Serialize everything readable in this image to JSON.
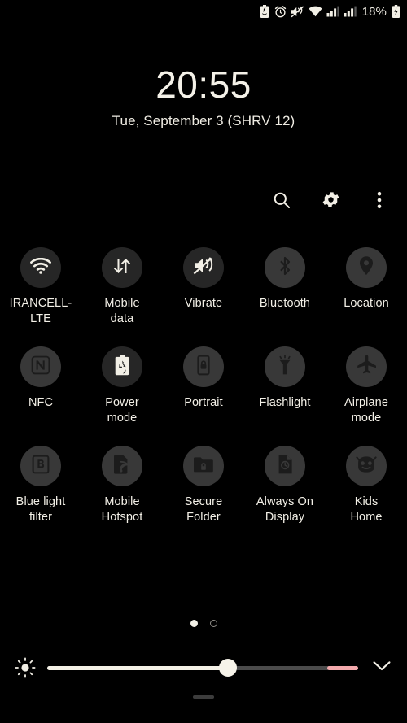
{
  "statusbar": {
    "icons": [
      {
        "name": "power-saving-icon",
        "glyph": "power-saving"
      },
      {
        "name": "alarm-icon",
        "glyph": "alarm"
      },
      {
        "name": "mute-vibrate-icon",
        "glyph": "mute"
      },
      {
        "name": "wifi-icon",
        "glyph": "wifi"
      },
      {
        "name": "signal-sim1-icon",
        "glyph": "signal"
      },
      {
        "name": "signal-sim2-icon",
        "glyph": "signal"
      }
    ],
    "battery_percent": "18%",
    "battery_state": "charging"
  },
  "header": {
    "time": "20:55",
    "date": "Tue, September 3 (SHRV 12)"
  },
  "toolbar": {
    "search_label": "search-icon",
    "settings_label": "gear-icon",
    "more_label": "more-vertical-icon"
  },
  "tiles": [
    {
      "name": "wifi",
      "label": "IRANCELL-\nLTE",
      "icon": "wifi-icon",
      "state": "on"
    },
    {
      "name": "mobile-data",
      "label": "Mobile\ndata",
      "icon": "data-arrows-icon",
      "state": "on"
    },
    {
      "name": "vibrate",
      "label": "Vibrate",
      "icon": "vibrate-icon",
      "state": "on"
    },
    {
      "name": "bluetooth",
      "label": "Bluetooth",
      "icon": "bluetooth-icon",
      "state": "off"
    },
    {
      "name": "location",
      "label": "Location",
      "icon": "location-pin-icon",
      "state": "off"
    },
    {
      "name": "nfc",
      "label": "NFC",
      "icon": "nfc-icon",
      "state": "off"
    },
    {
      "name": "power-mode",
      "label": "Power\nmode",
      "icon": "power-mode-icon",
      "state": "on"
    },
    {
      "name": "portrait",
      "label": "Portrait",
      "icon": "rotation-lock-icon",
      "state": "off"
    },
    {
      "name": "flashlight",
      "label": "Flashlight",
      "icon": "flashlight-icon",
      "state": "off"
    },
    {
      "name": "airplane-mode",
      "label": "Airplane\nmode",
      "icon": "airplane-icon",
      "state": "off"
    },
    {
      "name": "blue-light-filter",
      "label": "Blue light\nfilter",
      "icon": "blue-light-icon",
      "state": "off"
    },
    {
      "name": "mobile-hotspot",
      "label": "Mobile\nHotspot",
      "icon": "hotspot-icon",
      "state": "off"
    },
    {
      "name": "secure-folder",
      "label": "Secure\nFolder",
      "icon": "secure-folder-icon",
      "state": "off"
    },
    {
      "name": "always-on-display",
      "label": "Always On\nDisplay",
      "icon": "aod-icon",
      "state": "off"
    },
    {
      "name": "kids-home",
      "label": "Kids\nHome",
      "icon": "kids-home-icon",
      "state": "off"
    }
  ],
  "pager": {
    "total": 2,
    "active_index": 0
  },
  "brightness": {
    "value_percent": 58,
    "max_segment_percent": 10,
    "icon": "brightness-sun-icon",
    "expand_icon": "chevron-down-icon"
  },
  "colors": {
    "background": "#000000",
    "text": "#f3f0e7",
    "tile_on": "#262626",
    "tile_off": "#383838",
    "glyph_on": "#f2efe6",
    "glyph_off": "#1c1c1c",
    "slider_fill": "#f4f1e6",
    "slider_max": "#f3a9ac"
  }
}
